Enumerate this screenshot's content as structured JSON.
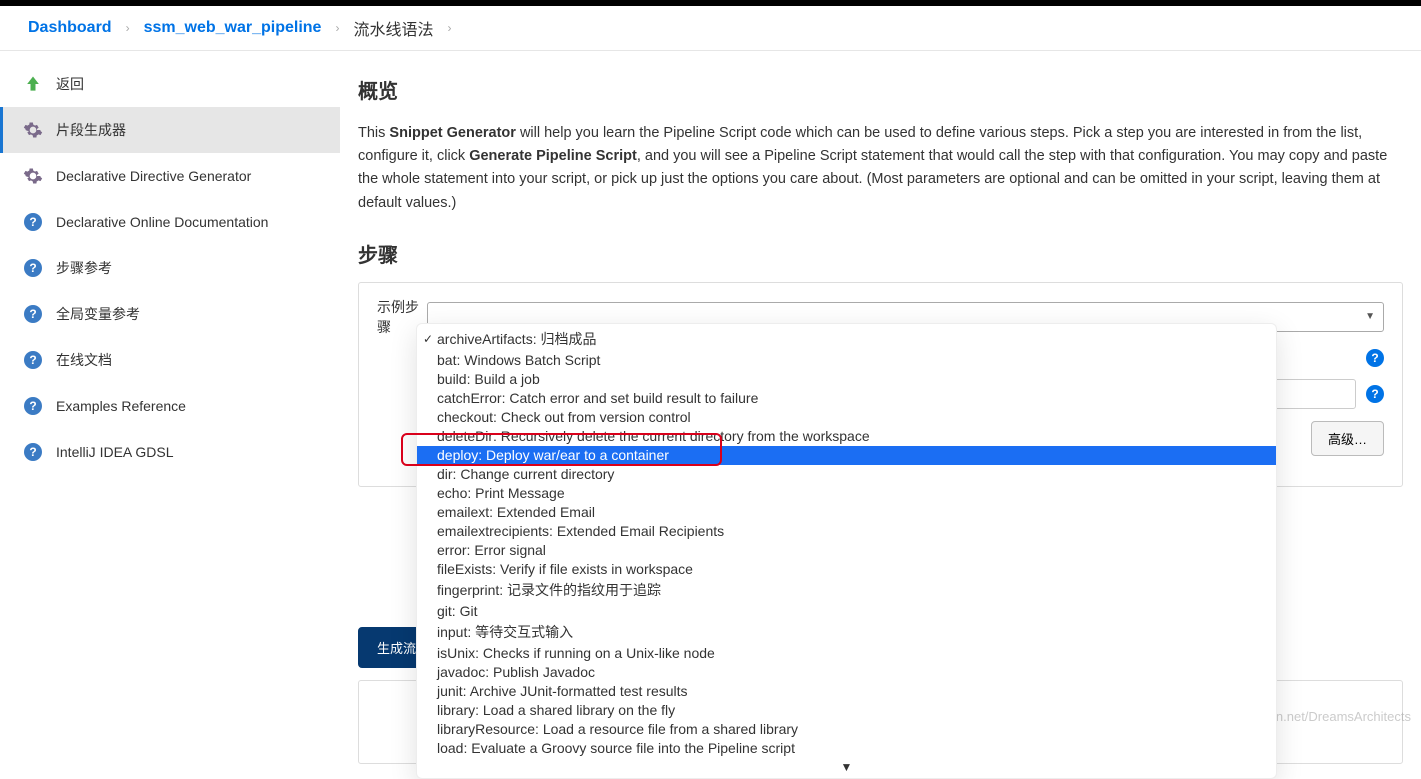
{
  "breadcrumb": {
    "dashboard": "Dashboard",
    "project": "ssm_web_war_pipeline",
    "current": "流水线语法"
  },
  "sidebar": {
    "items": [
      {
        "label": "返回",
        "icon": "arrow-up"
      },
      {
        "label": "片段生成器",
        "icon": "gear",
        "active": true
      },
      {
        "label": "Declarative Directive Generator",
        "icon": "gear"
      },
      {
        "label": "Declarative Online Documentation",
        "icon": "help"
      },
      {
        "label": "步骤参考",
        "icon": "help"
      },
      {
        "label": "全局变量参考",
        "icon": "help"
      },
      {
        "label": "在线文档",
        "icon": "help"
      },
      {
        "label": "Examples Reference",
        "icon": "help"
      },
      {
        "label": "IntelliJ IDEA GDSL",
        "icon": "help"
      }
    ]
  },
  "main": {
    "overview_title": "概览",
    "intro_this": "This ",
    "intro_snippet": "Snippet Generator",
    "intro_mid1": " will help you learn the Pipeline Script code which can be used to define various steps. Pick a step you are interested in from the list, configure it, click ",
    "intro_gen": "Generate Pipeline Script",
    "intro_mid2": ", and you will see a Pipeline Script statement that would call the step with that configuration. You may copy and paste the whole statement into your script, or pick up just the options you care about. (Most parameters are optional and can be omitted in your script, leaving them at default values.)",
    "steps_title": "步骤",
    "field_label": "示例步骤",
    "advanced_label": "高级…",
    "generate_label": "生成流",
    "help_glyph": "?"
  },
  "dropdown": {
    "items": [
      {
        "label": "archiveArtifacts: 归档成品",
        "checked": true
      },
      {
        "label": "bat: Windows Batch Script"
      },
      {
        "label": "build: Build a job"
      },
      {
        "label": "catchError: Catch error and set build result to failure"
      },
      {
        "label": "checkout: Check out from version control"
      },
      {
        "label": "deleteDir: Recursively delete the current directory from the workspace"
      },
      {
        "label": "deploy: Deploy war/ear to a container",
        "selected": true,
        "highlighted": true
      },
      {
        "label": "dir: Change current directory"
      },
      {
        "label": "echo: Print Message"
      },
      {
        "label": "emailext: Extended Email"
      },
      {
        "label": "emailextrecipients: Extended Email Recipients"
      },
      {
        "label": "error: Error signal"
      },
      {
        "label": "fileExists: Verify if file exists in workspace"
      },
      {
        "label": "fingerprint: 记录文件的指纹用于追踪"
      },
      {
        "label": "git: Git"
      },
      {
        "label": "input: 等待交互式输入"
      },
      {
        "label": "isUnix: Checks if running on a Unix-like node"
      },
      {
        "label": "javadoc: Publish Javadoc"
      },
      {
        "label": "junit: Archive JUnit-formatted test results"
      },
      {
        "label": "library: Load a shared library on the fly"
      },
      {
        "label": "libraryResource: Load a resource file from a shared library"
      },
      {
        "label": "load: Evaluate a Groovy source file into the Pipeline script"
      }
    ],
    "scroll_hint": "▼"
  },
  "watermark": "https://blog.csdn.net/DreamsArchitects"
}
